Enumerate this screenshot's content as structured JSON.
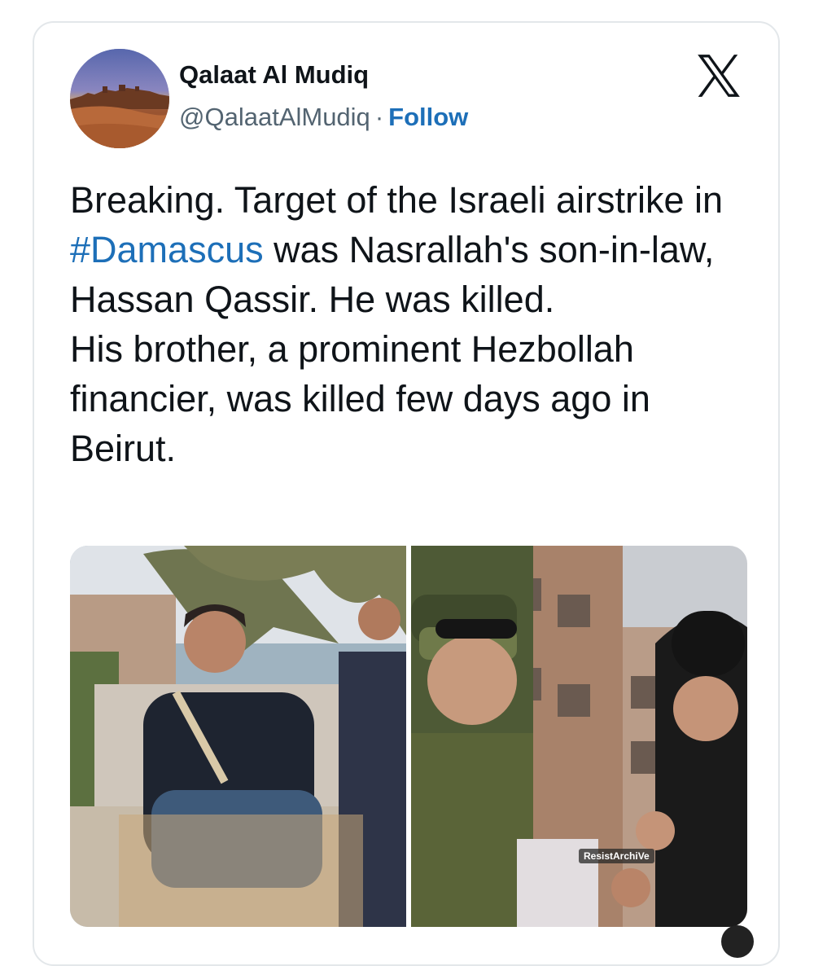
{
  "author": {
    "display_name": "Qalaat Al Mudiq",
    "handle": "@QalaatAlMudiq",
    "separator": "·",
    "follow_label": "Follow"
  },
  "tweet": {
    "text_before_hashtag": "Breaking. Target of the Israeli airstrike in ",
    "hashtag": "#Damascus",
    "text_after_hashtag": " was Nasrallah's son-in-law, Hassan Qassir. He was killed.",
    "second_paragraph": "His brother, a prominent Hezbollah financier, was killed few days ago in Beirut."
  },
  "media": {
    "watermark": "ResistArchiVe"
  },
  "icons": {
    "platform_logo": "x-logo-icon"
  },
  "colors": {
    "link": "#1d6fb8",
    "text": "#0f1419",
    "secondary": "#536471"
  }
}
